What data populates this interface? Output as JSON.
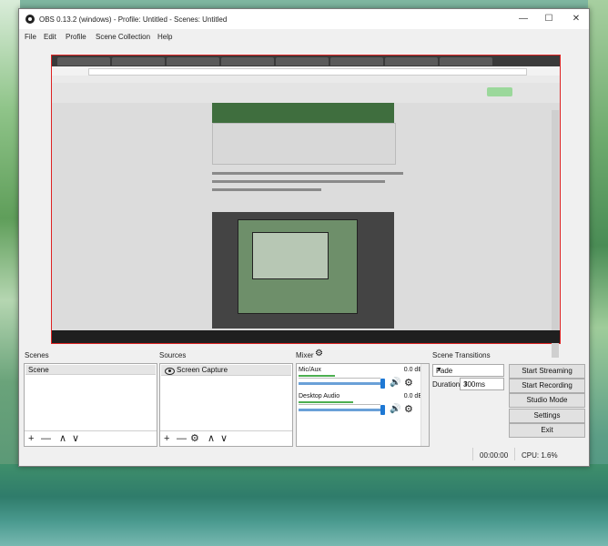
{
  "window": {
    "title": "OBS 0.13.2 (windows) - Profile: Untitled - Scenes: Untitled",
    "controls": {
      "minimize": "—",
      "maximize": "☐",
      "close": "✕"
    }
  },
  "menu": [
    "File",
    "Edit",
    "Profile",
    "Scene Collection",
    "Help"
  ],
  "docks": {
    "scenes": {
      "title": "Scenes",
      "items": [
        "Scene"
      ]
    },
    "sources": {
      "title": "Sources",
      "items": [
        "Screen Capture"
      ]
    },
    "mixer": {
      "title": "Mixer",
      "tracks": [
        {
          "name": "Mic/Aux",
          "db": "0.0 dB"
        },
        {
          "name": "Desktop Audio",
          "db": "0.0 dB"
        }
      ]
    },
    "transitions": {
      "title": "Scene Transitions",
      "type": "Fade",
      "duration_label": "Duration",
      "duration": "300ms"
    }
  },
  "controls": {
    "start_streaming": "Start Streaming",
    "start_recording": "Start Recording",
    "studio_mode": "Studio Mode",
    "settings": "Settings",
    "exit": "Exit"
  },
  "toolbar": {
    "add": "+",
    "remove": "—",
    "up": "∧",
    "down": "∨",
    "props": "⚙"
  },
  "status": {
    "time": "00:00:00",
    "cpu": "CPU: 1.6%"
  }
}
